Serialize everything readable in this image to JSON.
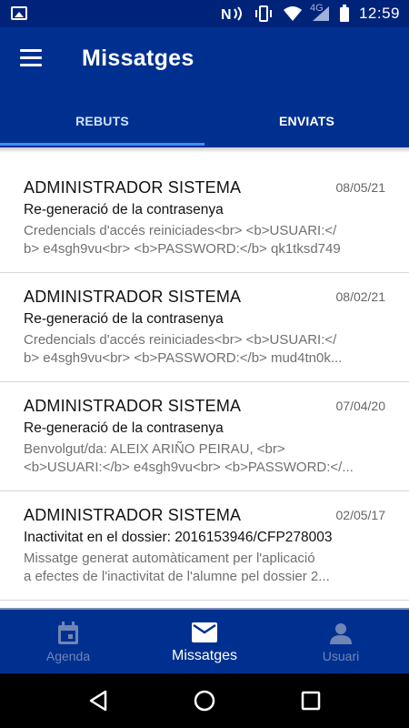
{
  "status_bar": {
    "network": "4G",
    "time": "12:59",
    "icons": [
      "image-icon",
      "nfc-icon",
      "vibrate-icon",
      "wifi-icon",
      "signal-icon",
      "battery-icon"
    ]
  },
  "app_bar": {
    "title": "Missatges",
    "menu_icon": "hamburger-menu-icon"
  },
  "tabs": [
    {
      "label": "REBUTS",
      "active": true
    },
    {
      "label": "ENVIATS",
      "active": false
    }
  ],
  "messages": [
    {
      "sender": "ADMINISTRADOR SISTEMA",
      "date": "08/05/21",
      "subject": "Re-generació de la contrasenya",
      "preview_line1": "Credencials d'accés reiniciades<br> <b>USUARI:</",
      "preview_line2": "b> e4sgh9vu<br> <b>PASSWORD:</b> qk1tksd749"
    },
    {
      "sender": "ADMINISTRADOR SISTEMA",
      "date": "08/02/21",
      "subject": "Re-generació de la contrasenya",
      "preview_line1": "Credencials d'accés reiniciades<br> <b>USUARI:</",
      "preview_line2": "b> e4sgh9vu<br> <b>PASSWORD:</b> mud4tn0k..."
    },
    {
      "sender": "ADMINISTRADOR SISTEMA",
      "date": "07/04/20",
      "subject": "Re-generació de la contrasenya",
      "preview_line1": "Benvolgut/da: ALEIX ARIÑO PEIRAU, <br>",
      "preview_line2": "<b>USUARI:</b> e4sgh9vu<br> <b>PASSWORD:</..."
    },
    {
      "sender": "ADMINISTRADOR SISTEMA",
      "date": "02/05/17",
      "subject": "Inactivitat en el dossier: 2016153946/CFP278003",
      "preview_line1": "Missatge generat automàticament per l'aplicació",
      "preview_line2": "a efectes de l'inactivitat de l'alumne pel dossier 2..."
    }
  ],
  "bottom_nav": [
    {
      "label": "Agenda",
      "icon": "calendar-icon",
      "active": false
    },
    {
      "label": "Missatges",
      "icon": "mail-icon",
      "active": true
    },
    {
      "label": "Usuari",
      "icon": "person-icon",
      "active": false
    }
  ],
  "system_nav": [
    "back-icon",
    "home-icon",
    "recents-icon"
  ],
  "colors": {
    "primary": "#00308f",
    "status_bar": "#00237a",
    "tab_indicator": "#3d8ef8",
    "inactive_nav": "#6f85b6"
  }
}
